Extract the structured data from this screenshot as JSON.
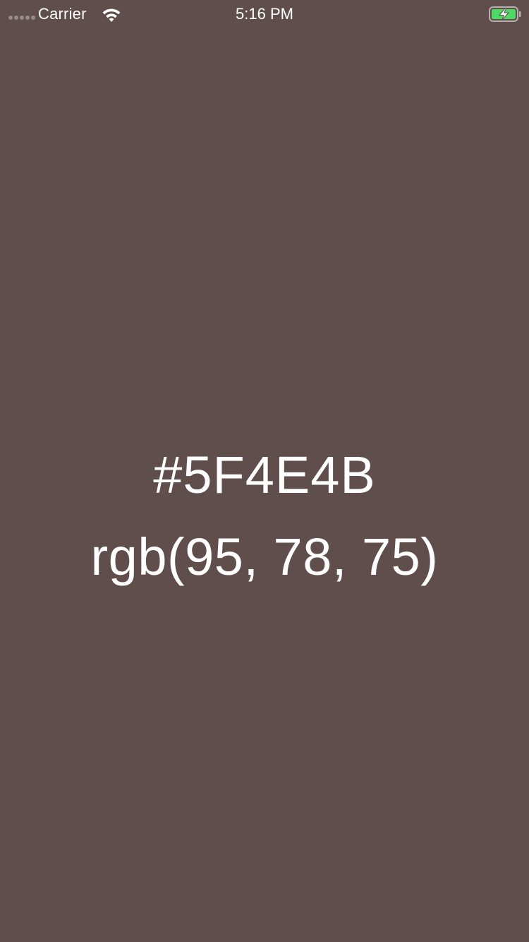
{
  "status_bar": {
    "carrier": "Carrier",
    "time": "5:16 PM",
    "signal_bars_filled": 0,
    "battery_charging": true,
    "battery_color": "#4CD964",
    "icons": [
      "signal-dots-icon",
      "wifi-icon",
      "battery-charging-icon"
    ]
  },
  "main": {
    "background_color": "#5F4E4B",
    "hex_text": "#5F4E4B",
    "rgb_text": "rgb(95, 78, 75)"
  }
}
